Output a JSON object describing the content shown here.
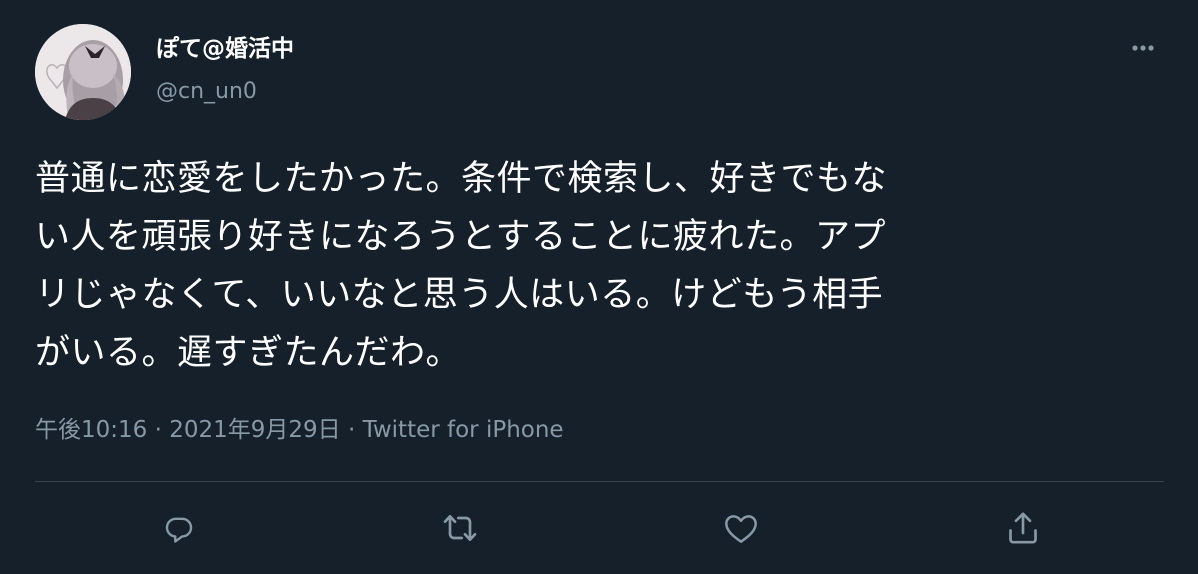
{
  "author": {
    "display_name": "ぽて@婚活中",
    "handle": "@cn_un0"
  },
  "tweet": {
    "text": "普通に恋愛をしたかった。条件で検索し、好きでもな\nい人を頑張り好きになろうとすることに疲れた。アプ\nリじゃなくて、いいなと思う人はいる。けどもう相手\nがいる。遅すぎたんだわ。"
  },
  "meta": {
    "time": "午後10:16",
    "separator1": " · ",
    "date": "2021年9月29日",
    "separator2": " · ",
    "source": "Twitter for iPhone"
  },
  "icons": {
    "more": "more-dots-icon",
    "reply": "reply-bubble-icon",
    "retweet": "retweet-arrows-icon",
    "like": "heart-icon",
    "share": "share-upload-icon"
  },
  "colors": {
    "background": "#15202b",
    "primary_text": "#ffffff",
    "secondary_text": "#8899a6",
    "divider": "#38444d"
  }
}
